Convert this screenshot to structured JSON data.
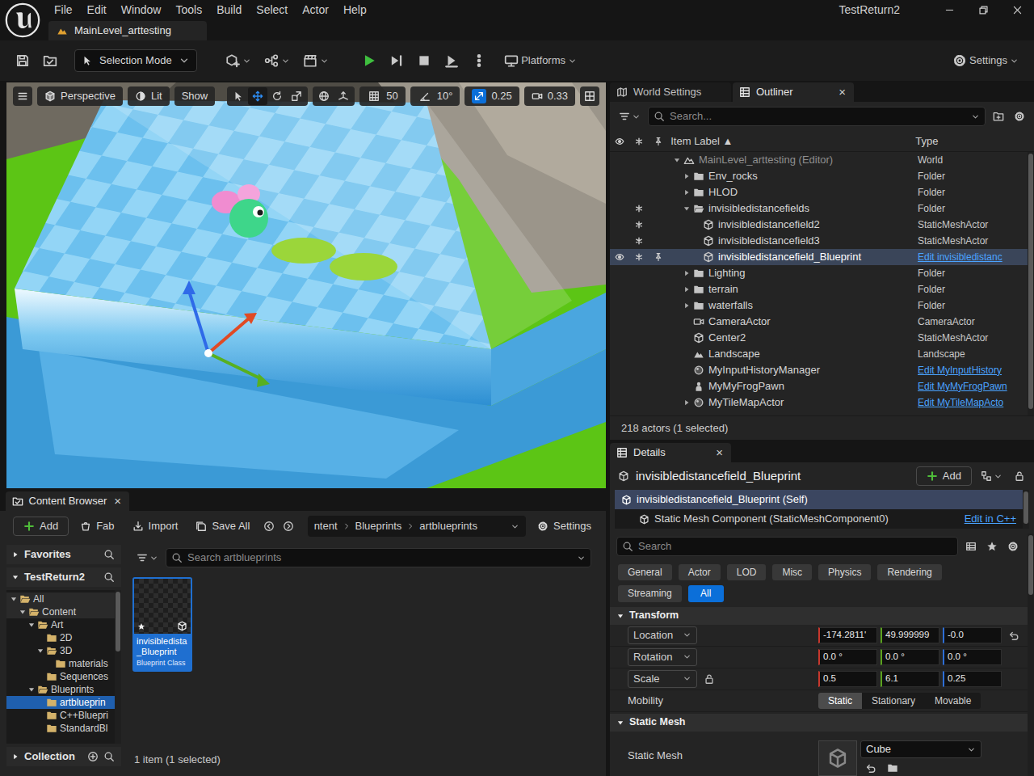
{
  "window": {
    "title": "TestReturn2"
  },
  "menu": [
    "File",
    "Edit",
    "Window",
    "Tools",
    "Build",
    "Select",
    "Actor",
    "Help"
  ],
  "level_tab": {
    "label": "MainLevel_arttesting"
  },
  "toolbar": {
    "mode": "Selection Mode",
    "platforms": "Platforms",
    "settings": "Settings"
  },
  "viewport": {
    "view": "Perspective",
    "lighting": "Lit",
    "show": "Show",
    "tools": [
      {
        "kind": "select",
        "selected": false
      },
      {
        "kind": "move",
        "selected": true
      },
      {
        "kind": "rotate",
        "selected": false
      },
      {
        "kind": "scale",
        "selected": false
      }
    ],
    "snaps": [
      {
        "kind": "grid",
        "value": "50",
        "on": false
      },
      {
        "kind": "angle",
        "value": "10°",
        "on": false
      },
      {
        "kind": "scale",
        "value": "0.25",
        "on": true
      }
    ],
    "camera_speed": "0.33"
  },
  "outliner": {
    "tabs": [
      {
        "label": "World Settings",
        "selected": false
      },
      {
        "label": "Outliner",
        "selected": true
      }
    ],
    "close": "×",
    "search": {
      "placeholder": "Search..."
    },
    "columns": [
      "Item Label ▲",
      "Type"
    ],
    "rows": [
      {
        "label": "MainLevel_arttesting (Editor)",
        "type": "World",
        "kind": "world",
        "depth": 0,
        "expandable": true,
        "expanded": true,
        "dimmed": true,
        "link": false,
        "selected": false,
        "modified": false,
        "show_eye": false,
        "show_pin": false
      },
      {
        "label": "Env_rocks",
        "type": "Folder",
        "kind": "folder",
        "depth": 1,
        "expandable": true,
        "expanded": false,
        "dimmed": false,
        "link": false,
        "selected": false,
        "modified": false,
        "show_eye": false,
        "show_pin": false
      },
      {
        "label": "HLOD",
        "type": "Folder",
        "kind": "folder",
        "depth": 1,
        "expandable": true,
        "expanded": false,
        "dimmed": false,
        "link": false,
        "selected": false,
        "modified": false,
        "show_eye": false,
        "show_pin": false
      },
      {
        "label": "invisibledistancefields",
        "type": "Folder",
        "kind": "folder",
        "depth": 1,
        "expandable": true,
        "expanded": true,
        "dimmed": false,
        "link": false,
        "selected": false,
        "modified": true,
        "show_eye": false,
        "show_pin": false
      },
      {
        "label": "invisibledistancefield2",
        "type": "StaticMeshActor",
        "kind": "mesh",
        "depth": 2,
        "expandable": false,
        "expanded": false,
        "dimmed": false,
        "link": false,
        "selected": false,
        "modified": true,
        "show_eye": false,
        "show_pin": false
      },
      {
        "label": "invisibledistancefield3",
        "type": "StaticMeshActor",
        "kind": "mesh",
        "depth": 2,
        "expandable": false,
        "expanded": false,
        "dimmed": false,
        "link": false,
        "selected": false,
        "modified": true,
        "show_eye": false,
        "show_pin": false
      },
      {
        "label": "invisibledistancefield_Blueprint",
        "type": "Edit invisibledistanc",
        "kind": "mesh",
        "depth": 2,
        "expandable": false,
        "expanded": false,
        "dimmed": false,
        "link": true,
        "selected": true,
        "modified": true,
        "show_eye": true,
        "show_pin": true
      },
      {
        "label": "Lighting",
        "type": "Folder",
        "kind": "folder",
        "depth": 1,
        "expandable": true,
        "expanded": false,
        "dimmed": false,
        "link": false,
        "selected": false,
        "modified": false,
        "show_eye": false,
        "show_pin": false
      },
      {
        "label": "terrain",
        "type": "Folder",
        "kind": "folder",
        "depth": 1,
        "expandable": true,
        "expanded": false,
        "dimmed": false,
        "link": false,
        "selected": false,
        "modified": false,
        "show_eye": false,
        "show_pin": false
      },
      {
        "label": "waterfalls",
        "type": "Folder",
        "kind": "folder",
        "depth": 1,
        "expandable": true,
        "expanded": false,
        "dimmed": false,
        "link": false,
        "selected": false,
        "modified": false,
        "show_eye": false,
        "show_pin": false
      },
      {
        "label": "CameraActor",
        "type": "CameraActor",
        "kind": "camera",
        "depth": 1,
        "expandable": false,
        "expanded": false,
        "dimmed": false,
        "link": false,
        "selected": false,
        "modified": false,
        "show_eye": false,
        "show_pin": false
      },
      {
        "label": "Center2",
        "type": "StaticMeshActor",
        "kind": "mesh",
        "depth": 1,
        "expandable": false,
        "expanded": false,
        "dimmed": false,
        "link": false,
        "selected": false,
        "modified": false,
        "show_eye": false,
        "show_pin": false
      },
      {
        "label": "Landscape",
        "type": "Landscape",
        "kind": "landscape",
        "depth": 1,
        "expandable": false,
        "expanded": false,
        "dimmed": false,
        "link": false,
        "selected": false,
        "modified": false,
        "show_eye": false,
        "show_pin": false
      },
      {
        "label": "MyInputHistoryManager",
        "type": "Edit MyInputHistory",
        "kind": "actor",
        "depth": 1,
        "expandable": false,
        "expanded": false,
        "dimmed": false,
        "link": true,
        "selected": false,
        "modified": false,
        "show_eye": false,
        "show_pin": false
      },
      {
        "label": "MyMyFrogPawn",
        "type": "Edit MyMyFrogPawn",
        "kind": "pawn",
        "depth": 1,
        "expandable": false,
        "expanded": false,
        "dimmed": false,
        "link": true,
        "selected": false,
        "modified": false,
        "show_eye": false,
        "show_pin": false
      },
      {
        "label": "MyTileMapActor",
        "type": "Edit MyTileMapActo",
        "kind": "actor",
        "depth": 1,
        "expandable": true,
        "expanded": false,
        "dimmed": false,
        "link": true,
        "selected": false,
        "modified": false,
        "show_eye": false,
        "show_pin": false
      }
    ],
    "footer": "218 actors (1 selected)"
  },
  "details": {
    "tab": "Details",
    "close": "×",
    "actor": "invisibledistancefield_Blueprint",
    "add": "Add",
    "components": [
      {
        "label": "invisibledistancefield_Blueprint (Self)",
        "selected": true
      },
      {
        "label": "Static Mesh Component (StaticMeshComponent0)",
        "action": "Edit in C++",
        "selected": false
      }
    ],
    "search": {
      "placeholder": "Search"
    },
    "filters": [
      {
        "label": "General",
        "selected": false
      },
      {
        "label": "Actor",
        "selected": false
      },
      {
        "label": "LOD",
        "selected": false
      },
      {
        "label": "Misc",
        "selected": false
      },
      {
        "label": "Physics",
        "selected": false
      },
      {
        "label": "Rendering",
        "selected": false
      },
      {
        "label": "Streaming",
        "selected": false
      },
      {
        "label": "All",
        "selected": true
      }
    ],
    "axes": [
      {
        "color": "#c8372d"
      },
      {
        "color": "#5aa21e"
      },
      {
        "color": "#2d6ed6"
      }
    ],
    "transform": {
      "title": "Transform",
      "expanded": true,
      "rows": [
        {
          "label": "Location",
          "values": [
            "-174.2811'",
            "49.999999",
            "-0.0"
          ],
          "reset": true,
          "lock_icon": false
        },
        {
          "label": "Rotation",
          "values": [
            "0.0 °",
            "0.0 °",
            "0.0 °"
          ],
          "reset": false,
          "lock_icon": false
        },
        {
          "label": "Scale",
          "values": [
            "0.5",
            "6.1",
            "0.25"
          ],
          "reset": false,
          "lock_icon": true
        }
      ],
      "mobility": {
        "label": "Mobility",
        "options": [
          {
            "label": "Static",
            "selected": true
          },
          {
            "label": "Stationary",
            "selected": false
          },
          {
            "label": "Movable",
            "selected": false
          }
        ]
      }
    },
    "static_mesh": {
      "title": "Static Mesh",
      "expanded": true,
      "label": "Static Mesh",
      "value": "Cube"
    }
  },
  "content_browser": {
    "tab": "Content Browser",
    "close": "×",
    "add": "Add",
    "fab": "Fab",
    "import": "Import",
    "save_all": "Save All",
    "path": [
      "ntent",
      "Blueprints",
      "artblueprints"
    ],
    "settings": "Settings",
    "favorites": {
      "label": "Favorites",
      "expanded": false
    },
    "project": {
      "label": "TestReturn2",
      "expanded": true
    },
    "tree": [
      {
        "label": "All",
        "depth": 0,
        "expandable": true,
        "expanded": true,
        "selected": false
      },
      {
        "label": "Content",
        "depth": 1,
        "expandable": true,
        "expanded": true,
        "selected": false
      },
      {
        "label": "Art",
        "depth": 2,
        "expandable": true,
        "expanded": true,
        "selected": false
      },
      {
        "label": "2D",
        "depth": 3,
        "expandable": false,
        "expanded": false,
        "selected": false
      },
      {
        "label": "3D",
        "depth": 3,
        "expandable": true,
        "expanded": true,
        "selected": false
      },
      {
        "label": "materials",
        "depth": 4,
        "expandable": false,
        "expanded": false,
        "selected": false
      },
      {
        "label": "Sequences",
        "depth": 3,
        "expandable": false,
        "expanded": false,
        "selected": false
      },
      {
        "label": "Blueprints",
        "depth": 2,
        "expandable": true,
        "expanded": true,
        "selected": false
      },
      {
        "label": "artblueprin",
        "depth": 3,
        "expandable": false,
        "expanded": false,
        "selected": true
      },
      {
        "label": "C++Bluepri",
        "depth": 3,
        "expandable": false,
        "expanded": false,
        "selected": false
      },
      {
        "label": "StandardBl",
        "depth": 3,
        "expandable": false,
        "expanded": false,
        "selected": false
      }
    ],
    "collections": {
      "label": "Collection",
      "expanded": false
    },
    "search": {
      "placeholder": "Search artblueprints"
    },
    "assets": [
      {
        "name_lines": [
          "invisibledista",
          "_Blueprint"
        ],
        "type": "Blueprint Class",
        "selected": true
      }
    ],
    "status": "1 item (1 selected)"
  }
}
